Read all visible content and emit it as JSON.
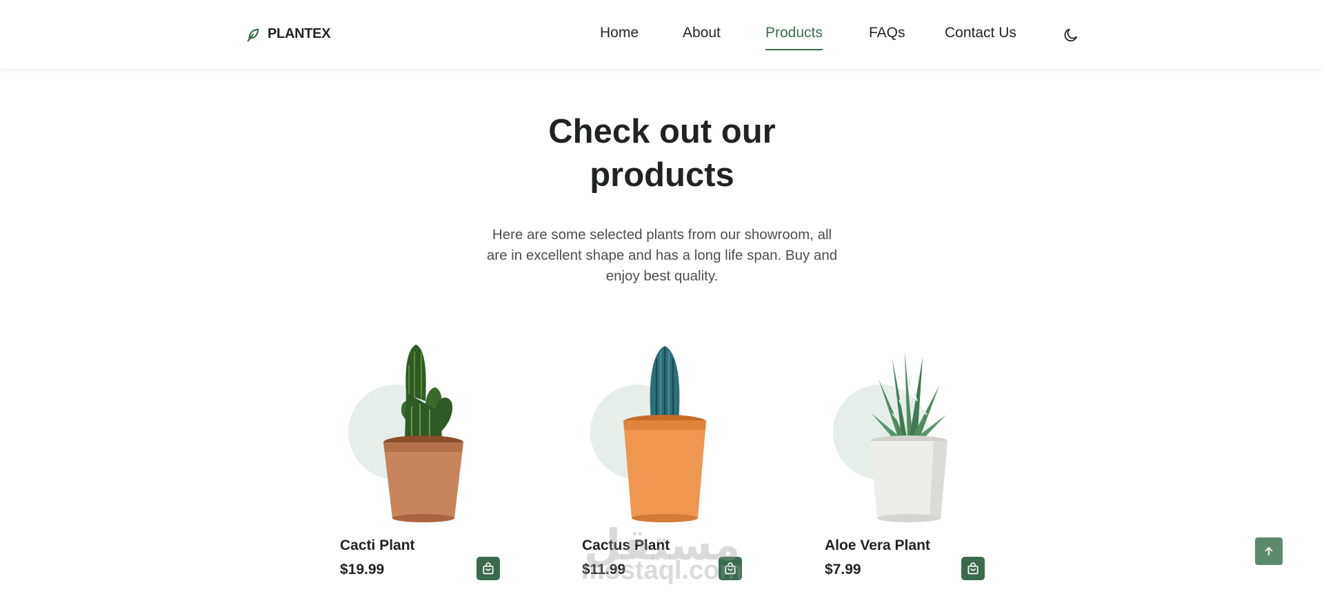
{
  "brand": {
    "name": "PLANTEX",
    "icon": "leaf-icon"
  },
  "nav": {
    "items": [
      {
        "label": "Home",
        "active": false
      },
      {
        "label": "About",
        "active": false
      },
      {
        "label": "Products",
        "active": true
      },
      {
        "label": "FAQs",
        "active": false
      },
      {
        "label": "Contact Us",
        "active": false
      }
    ],
    "theme_toggle_icon": "moon-icon"
  },
  "section": {
    "title_line1": "Check out our",
    "title_line2": "products",
    "description_line1": "Here are some selected plants from our showroom, all",
    "description_line2": "are in excellent shape and has a long life span. Buy and",
    "description_line3": "enjoy best quality."
  },
  "products": [
    {
      "name": "Cacti Plant",
      "price": "$19.99",
      "pot_color": "#c8845a",
      "plant": "cactus-green"
    },
    {
      "name": "Cactus Plant",
      "price": "$11.99",
      "pot_color": "#ef9650",
      "plant": "cactus-blue"
    },
    {
      "name": "Aloe Vera Plant",
      "price": "$7.99",
      "pot_color": "#ecece8",
      "plant": "aloe"
    }
  ],
  "watermark": {
    "arabic": "مستقل",
    "latin": "mostaql.com"
  },
  "colors": {
    "accent": "#3a6b4c",
    "circle_bg": "#e6eeea",
    "scroll_btn": "#5c8a6d"
  }
}
